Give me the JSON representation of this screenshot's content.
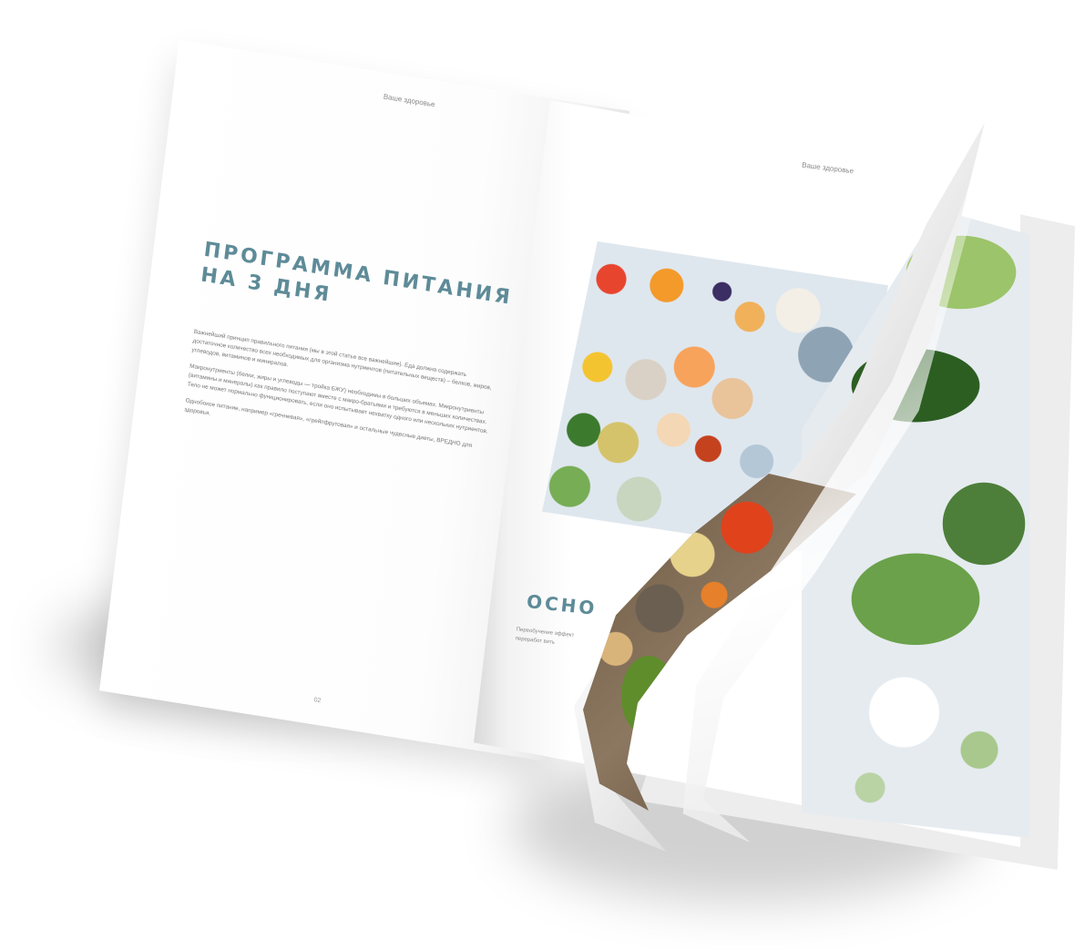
{
  "left_page": {
    "running_header": "Ваше здоровье",
    "title_line1": "ПРОГРАММА ПИТАНИЯ",
    "title_line2": "НА 3 ДНЯ",
    "paragraph1": "Важнейший принцип правильного питания (мы в этой статье все важнейшие). Еда должна содержать достаточное количество всех необходимых для организма нутриентов (питательных веществ) – белков, жиров, углеводов, витаминов и минералов.",
    "paragraph2": "Макронутриенты (белки, жиры и углеводы — тройка БЖУ) необходимы в больших объемах. Микронутриенты (витамины и минералы) как правило поступают вместе с макро-братьями и требуются в меньших количествах. Тело не может нормально функционировать, если оно испытывает нехватку одного или нескольких нутриентов.",
    "paragraph3": "Однобокое питание, например «гречневая», «грейпфрутовая» и остальные чудесные диеты, ВРЕДНО для здоровья.",
    "page_number": "02"
  },
  "right_page": {
    "running_header": "Ваше здоровье",
    "heading_partial": "ОСНО",
    "text_partial": "Переобучение эффект переработ вить"
  }
}
